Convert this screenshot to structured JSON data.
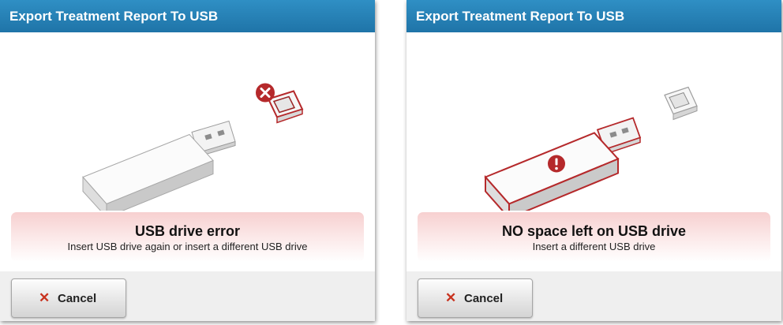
{
  "dialogs": [
    {
      "title": "Export Treatment Report To USB",
      "message_title": "USB drive error",
      "message_body": "Insert USB drive again or insert a different USB drive",
      "cancel_label": "Cancel",
      "cancel_icon": "close-x-icon",
      "status_icon": "error-circle-x-icon",
      "highlight": "usb-port"
    },
    {
      "title": "Export Treatment Report To USB",
      "message_title": "NO space left on USB drive",
      "message_body": "Insert a different USB drive",
      "cancel_label": "Cancel",
      "cancel_icon": "close-x-icon",
      "status_icon": "exclamation-circle-icon",
      "highlight": "usb-drive"
    }
  ],
  "colors": {
    "titlebar": "#1f74a8",
    "error_red": "#b5292b",
    "message_background": "#f7d0d0",
    "cancel_x": "#c8321e"
  }
}
